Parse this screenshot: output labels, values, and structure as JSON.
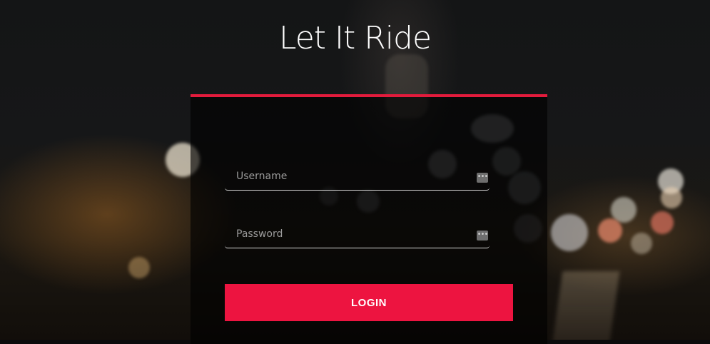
{
  "page": {
    "title": "Let It Ride"
  },
  "login_form": {
    "username_placeholder": "Username",
    "password_placeholder": "Password",
    "submit_label": "LOGIN",
    "field_icon": "dots-icon"
  },
  "colors": {
    "accent": "#e21b3c",
    "button": "#ed1440",
    "panel": "rgba(0,0,0,0.62)",
    "text": "#ffffff"
  }
}
